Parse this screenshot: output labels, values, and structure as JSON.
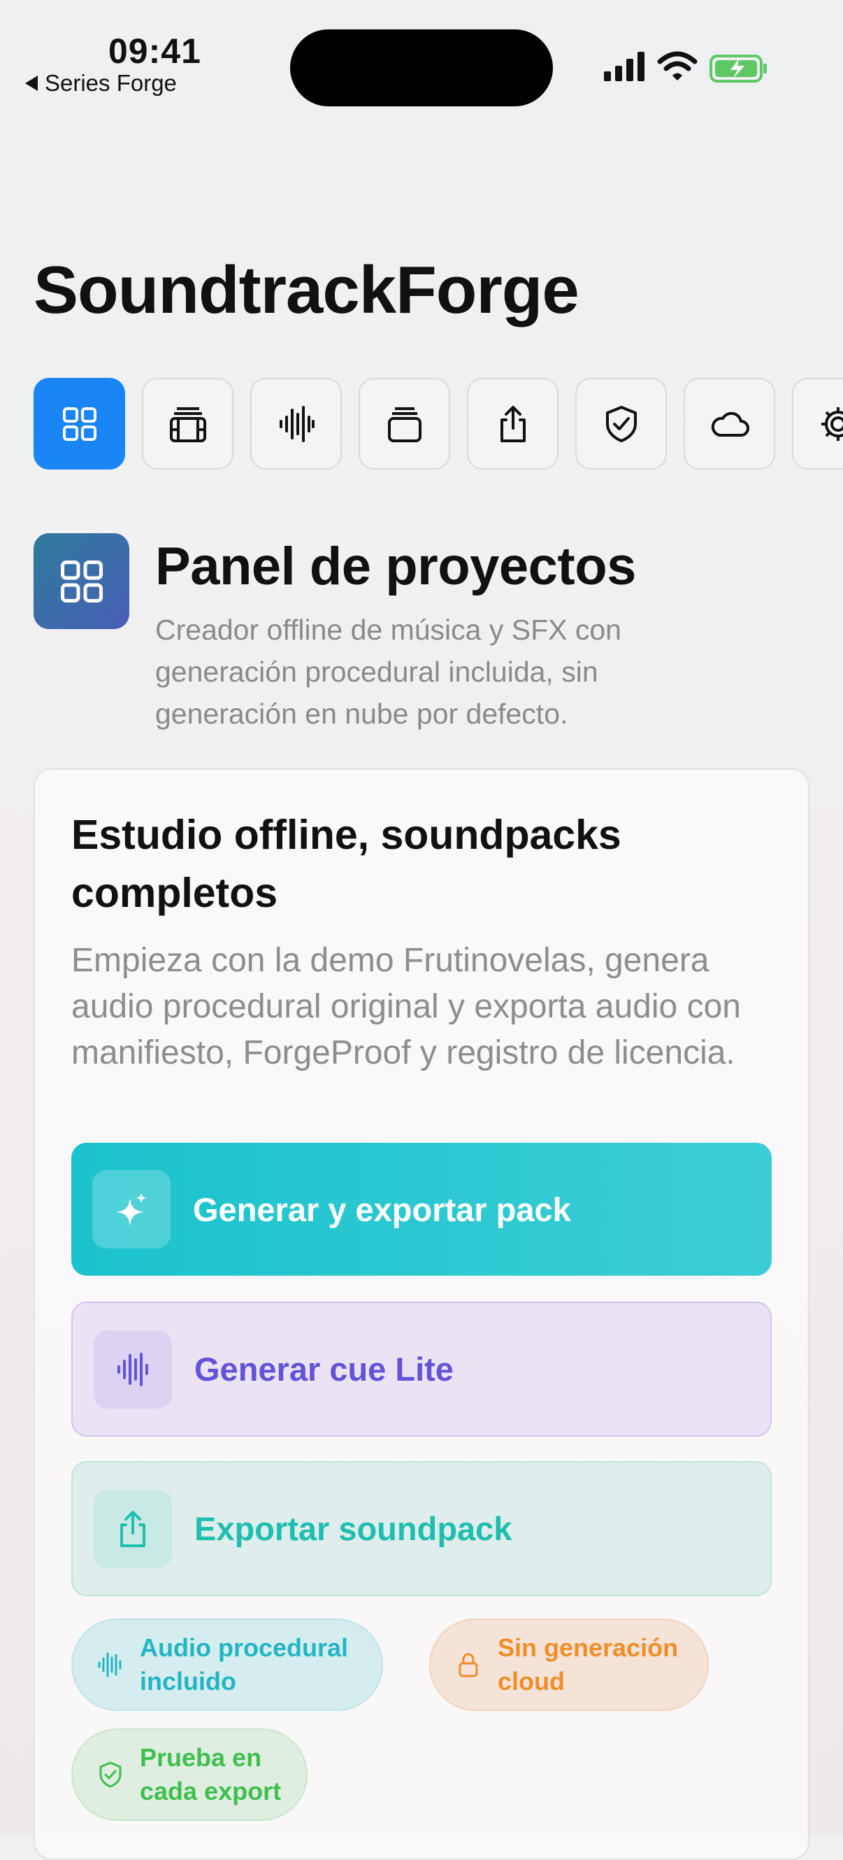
{
  "status_bar": {
    "time": "09:41",
    "back_label": "Series Forge"
  },
  "app": {
    "title": "SoundtrackForge"
  },
  "tabs": [
    {
      "icon": "grid-icon",
      "active": true
    },
    {
      "icon": "film-stack-icon",
      "active": false
    },
    {
      "icon": "waveform-icon",
      "active": false
    },
    {
      "icon": "stack-icon",
      "active": false
    },
    {
      "icon": "share-icon",
      "active": false
    },
    {
      "icon": "shield-check-icon",
      "active": false
    },
    {
      "icon": "cloud-icon",
      "active": false
    },
    {
      "icon": "gear-icon",
      "active": false
    }
  ],
  "panel": {
    "title": "Panel de proyectos",
    "subtitle": "Creador offline de música y SFX con generación procedural incluida, sin generación en nube por defecto."
  },
  "card": {
    "title": "Estudio offline, soundpacks completos",
    "description": "Empieza con la demo Frutinovelas, genera audio procedural original y exporta audio con manifiesto, ForgeProof y registro de licencia.",
    "buttons": [
      {
        "label": "Generar y exportar pack",
        "icon": "sparkles-icon"
      },
      {
        "label": "Generar cue Lite",
        "icon": "waveform-icon"
      },
      {
        "label": "Exportar soundpack",
        "icon": "share-icon"
      }
    ],
    "chips": [
      {
        "label": "Audio procedural incluido",
        "icon": "waveform-icon"
      },
      {
        "label": "Sin generación cloud",
        "icon": "lock-icon"
      },
      {
        "label": "Prueba en cada export",
        "icon": "shield-check-icon"
      }
    ]
  },
  "colors": {
    "accent_blue": "#1a86f5",
    "teal_button": "#1bc3cc",
    "purple_text": "#6353d8",
    "mint_text": "#1fbfb0",
    "orange_text": "#ef8e28",
    "green_text": "#3fbf4f"
  }
}
